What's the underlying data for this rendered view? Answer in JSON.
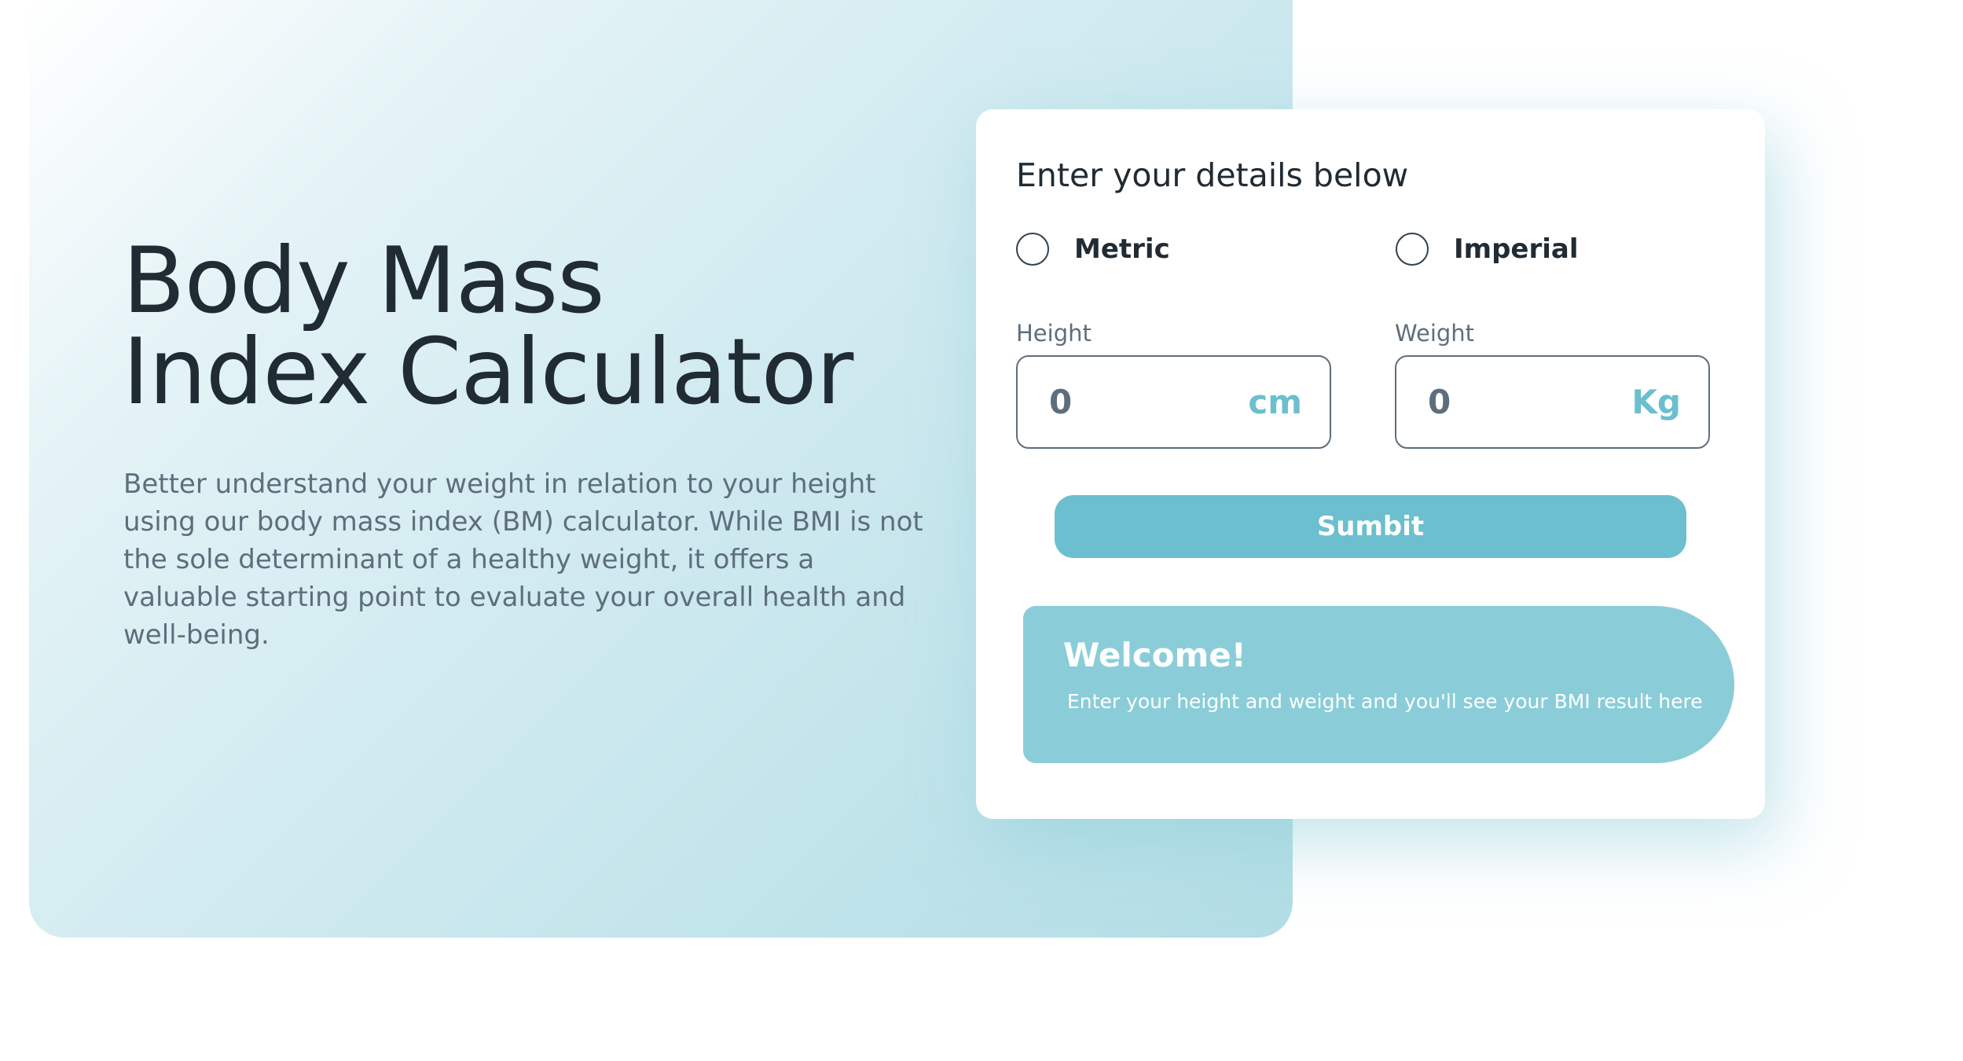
{
  "hero": {
    "title_line1": "Body Mass",
    "title_line2": "Index Calculator",
    "description": "Better understand your weight in relation to your height using our body mass index (BM) calculator. While BMI is not the sole determinant of a healthy weight, it offers a valuable starting point to evaluate your overall health and well-being."
  },
  "form": {
    "title": "Enter your details below",
    "units": {
      "metric_label": "Metric",
      "imperial_label": "Imperial",
      "selected": ""
    },
    "height": {
      "label": "Height",
      "value": "0",
      "unit": "cm"
    },
    "weight": {
      "label": "Weight",
      "value": "0",
      "unit": "Kg"
    },
    "submit_label": "Sumbit"
  },
  "result": {
    "title": "Welcome!",
    "message": "Enter your height and weight and you'll see your BMI result here"
  },
  "colors": {
    "accent": "#6bbfce",
    "result_bg": "#8acdd9",
    "heading": "#202b33",
    "body_text": "#5e6e7c"
  }
}
